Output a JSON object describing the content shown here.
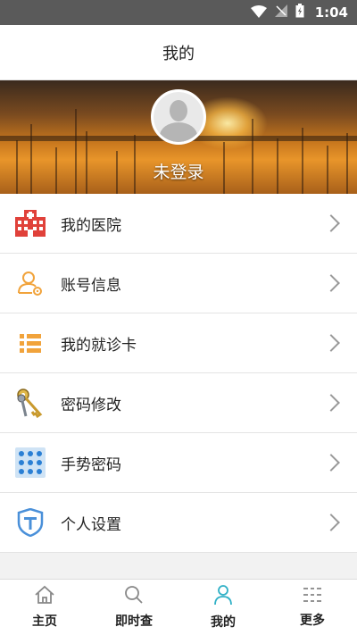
{
  "status_bar": {
    "time": "1:04"
  },
  "header": {
    "title": "我的"
  },
  "profile": {
    "login_text": "未登录"
  },
  "menu": {
    "items": [
      {
        "label": "我的医院",
        "icon": "hospital-icon"
      },
      {
        "label": "账号信息",
        "icon": "account-icon"
      },
      {
        "label": "我的就诊卡",
        "icon": "card-list-icon"
      },
      {
        "label": "密码修改",
        "icon": "keys-icon"
      },
      {
        "label": "手势密码",
        "icon": "gesture-grid-icon"
      },
      {
        "label": "个人设置",
        "icon": "shield-settings-icon"
      }
    ]
  },
  "bottom_nav": {
    "items": [
      {
        "label": "主页",
        "icon": "home-icon"
      },
      {
        "label": "即时查",
        "icon": "search-icon"
      },
      {
        "label": "我的",
        "icon": "person-icon",
        "active": true
      },
      {
        "label": "更多",
        "icon": "more-icon"
      }
    ]
  },
  "colors": {
    "accent": "#2fb0c6",
    "hospital_red": "#e0413a",
    "orange": "#f1a33b",
    "blue": "#4a90d9"
  }
}
